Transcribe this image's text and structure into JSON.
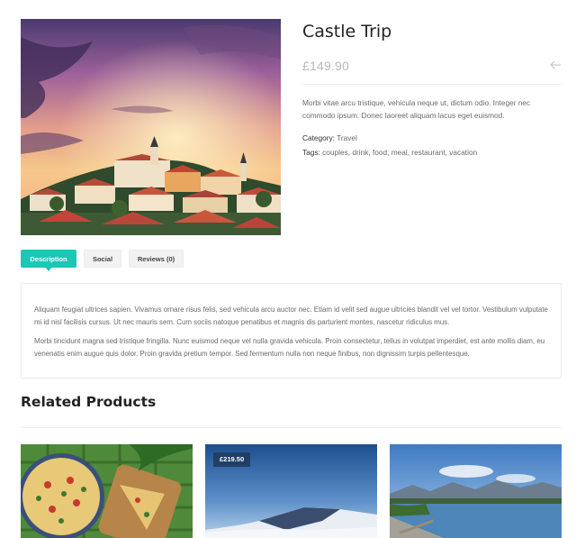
{
  "product": {
    "title": "Castle Trip",
    "price": "£149.90",
    "short_description": "Morbi vitae arcu tristique, vehicula neque ut, dictum odio. Integer nec commodo ipsum. Donec laoreet aliquam lacus eget euismod.",
    "category_label": "Category:",
    "category_value": "Travel",
    "tags_label": "Tags:",
    "tags_value": "couples, drink, food, meal, restaurant, vacation",
    "image_icon": "castle-town-sunset-photo"
  },
  "tabs": {
    "description": "Description",
    "social": "Social",
    "reviews": "Reviews (0)",
    "active": "description"
  },
  "tab_panel": {
    "paragraph_1": "Aliquam feugiat ultrices sapien. Vivamus ornare risus felis, sed vehicula arcu auctor nec. Etiam id velit sed augue ultricies blandit vel vel tortor. Vestibulum vulputate mi id nisl facilisis cursus. Ut nec mauris sem. Cum sociis natoque penatibus et magnis dis parturient montes, nascetur ridiculus mus.",
    "paragraph_2": "Morbi tincidunt magna sed tristique fringilla. Nunc euismod neque vel nulla gravida vehicula. Proin consectetur, tellus in volutpat imperdiet, est ante mollis diam, eu venenatis enim augue quis dolor. Proin gravida pretium tempor. Sed fermentum nulla non neque finibus, non dignissim turpis pellentesque."
  },
  "related": {
    "title": "Related Products",
    "items": [
      {
        "image": "quiche-food-photo"
      },
      {
        "image": "snowy-mountain-photo",
        "price_badge": "£219.50"
      },
      {
        "image": "mountain-lake-photo"
      }
    ]
  },
  "colors": {
    "accent": "#1cc7b5",
    "badge": "#1f3f66"
  }
}
